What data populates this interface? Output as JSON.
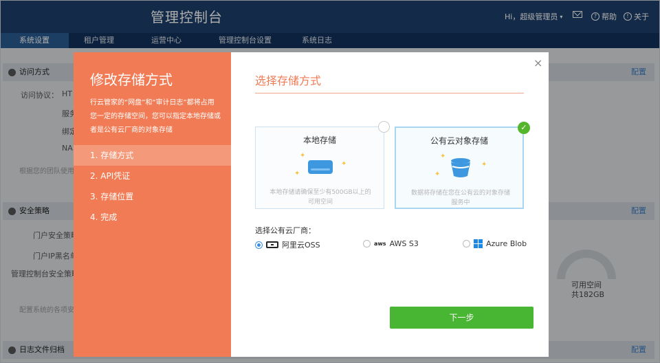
{
  "header": {
    "title": "管理控制台",
    "user": "Hi，超级管理员",
    "help": "帮助",
    "about": "关于",
    "help_icon": "question-icon",
    "about_icon": "info-icon"
  },
  "nav": {
    "items": [
      "系统设置",
      "租户管理",
      "运营中心",
      "管理控制台设置",
      "系统日志"
    ]
  },
  "background": {
    "sections": [
      {
        "title": "访问方式",
        "action": "配置"
      },
      {
        "title": "安全策略",
        "action": "配置"
      },
      {
        "title": "日志文件归档",
        "action": "配置"
      }
    ],
    "access_label": "访问协议：",
    "access_value": "HT",
    "rows1": [
      "服务",
      "绑定",
      "NA"
    ],
    "note1": "根据您的团队使用习",
    "rows2": [
      "门户安全策略",
      "门户IP黑名单",
      "管理控制台安全策略"
    ],
    "note2": "配置系统的各项安全",
    "gauge_label": "可用空间",
    "gauge_value": "共182GB"
  },
  "modal": {
    "title": "修改存储方式",
    "description": "行云管家的“网盘”和“审计日志”都将占用您一定的存储空间，您可以指定本地存储或者是公有云厂商的对象存储",
    "steps": [
      "1. 存储方式",
      "2. API凭证",
      "3. 存储位置",
      "4. 完成"
    ],
    "active_step": 0,
    "close_label": "×",
    "section_title": "选择存储方式",
    "cards": [
      {
        "title": "本地存储",
        "desc": "本地存储请确保至少有500GB以上的可用空间",
        "selected": false,
        "icon": "hard-drive-icon"
      },
      {
        "title": "公有云对象存储",
        "desc": "数据将存储在您在公有云的对象存储服务中",
        "selected": true,
        "icon": "bucket-icon"
      }
    ],
    "provider_label": "选择公有云厂商：",
    "providers": [
      {
        "name": "阿里云OSS",
        "logo": "aliyun-logo",
        "selected": true
      },
      {
        "name": "AWS S3",
        "logo": "aws-logo",
        "logo_text": "aws",
        "selected": false
      },
      {
        "name": "Azure Blob",
        "logo": "windows-logo",
        "selected": false
      }
    ],
    "next_label": "下一步",
    "colors": {
      "accent": "#f07b54",
      "primary": "#48b533",
      "header": "#1c3e6b"
    }
  }
}
